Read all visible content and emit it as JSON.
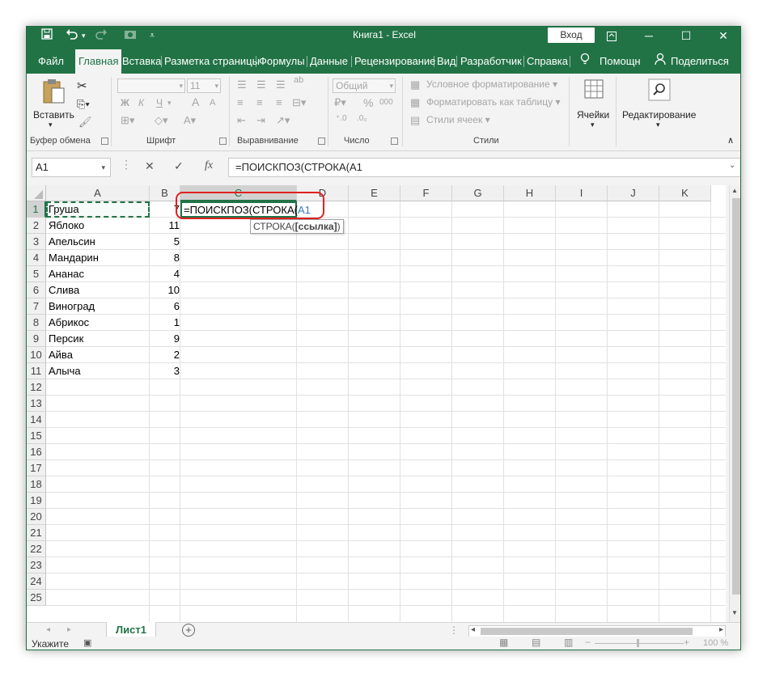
{
  "window": {
    "title": "Книга1  -  Excel",
    "login_label": "Вход",
    "accent": "#217346"
  },
  "quick_access": {
    "icons": [
      "save-icon",
      "undo-icon",
      "redo-icon",
      "camera-icon",
      "customize-icon"
    ]
  },
  "tabs": [
    "Файл",
    "Главная",
    "Вставка",
    "Разметка страницы",
    "Формулы",
    "Данные",
    "Рецензирование",
    "Вид",
    "Разработчик",
    "Справка"
  ],
  "tell_me": "Помощн",
  "share": "Поделиться",
  "ribbon": {
    "clipboard": {
      "paste_label": "Вставить",
      "group_label": "Буфер обмена"
    },
    "font": {
      "size_value": "11",
      "bold": "Ж",
      "italic": "К",
      "underline": "Ч",
      "grow": "A",
      "shrink": "A",
      "font_color": "A",
      "group_label": "Шрифт"
    },
    "alignment": {
      "wrap": "ab",
      "group_label": "Выравнивание"
    },
    "number": {
      "format_value": "Общий",
      "percent": "%",
      "thousands": "000",
      "group_label": "Число"
    },
    "styles": {
      "conditional": "Условное форматирование",
      "as_table": "Форматировать как таблицу",
      "cell_styles": "Стили ячеек",
      "group_label": "Стили"
    },
    "cells_label": "Ячейки",
    "editing_label": "Редактирование"
  },
  "formula_bar": {
    "name_box": "A1",
    "formula": "=ПОИСКПОЗ(СТРОКА(A1",
    "fx": "fx"
  },
  "columns": [
    "A",
    "B",
    "C",
    "D",
    "E",
    "F",
    "G",
    "H",
    "I",
    "J",
    "K"
  ],
  "rows": [
    "1",
    "2",
    "3",
    "4",
    "5",
    "6",
    "7",
    "8",
    "9",
    "10",
    "11",
    "12",
    "13",
    "14",
    "15",
    "16",
    "17",
    "18",
    "19",
    "20",
    "21",
    "22",
    "23",
    "24",
    "25"
  ],
  "data_rows": [
    {
      "fruit": "Груша",
      "value": "7"
    },
    {
      "fruit": "Яблоко",
      "value": "11"
    },
    {
      "fruit": "Апельсин",
      "value": "5"
    },
    {
      "fruit": "Мандарин",
      "value": "8"
    },
    {
      "fruit": "Ананас",
      "value": "4"
    },
    {
      "fruit": "Слива",
      "value": "10"
    },
    {
      "fruit": "Виноград",
      "value": "6"
    },
    {
      "fruit": "Абрикос",
      "value": "1"
    },
    {
      "fruit": "Персик",
      "value": "9"
    },
    {
      "fruit": "Айва",
      "value": "2"
    },
    {
      "fruit": "Алыча",
      "value": "3"
    }
  ],
  "edit_cell": {
    "formula_prefix": "=ПОИСКПОЗ(СТРОКА(",
    "formula_ref": "A1",
    "tooltip_func": "СТРОКА(",
    "tooltip_arg": "[ссылка]",
    "tooltip_close": ")"
  },
  "sheets": [
    "Лист1"
  ],
  "status": {
    "mode": "Укажите",
    "zoom": "100 %"
  }
}
